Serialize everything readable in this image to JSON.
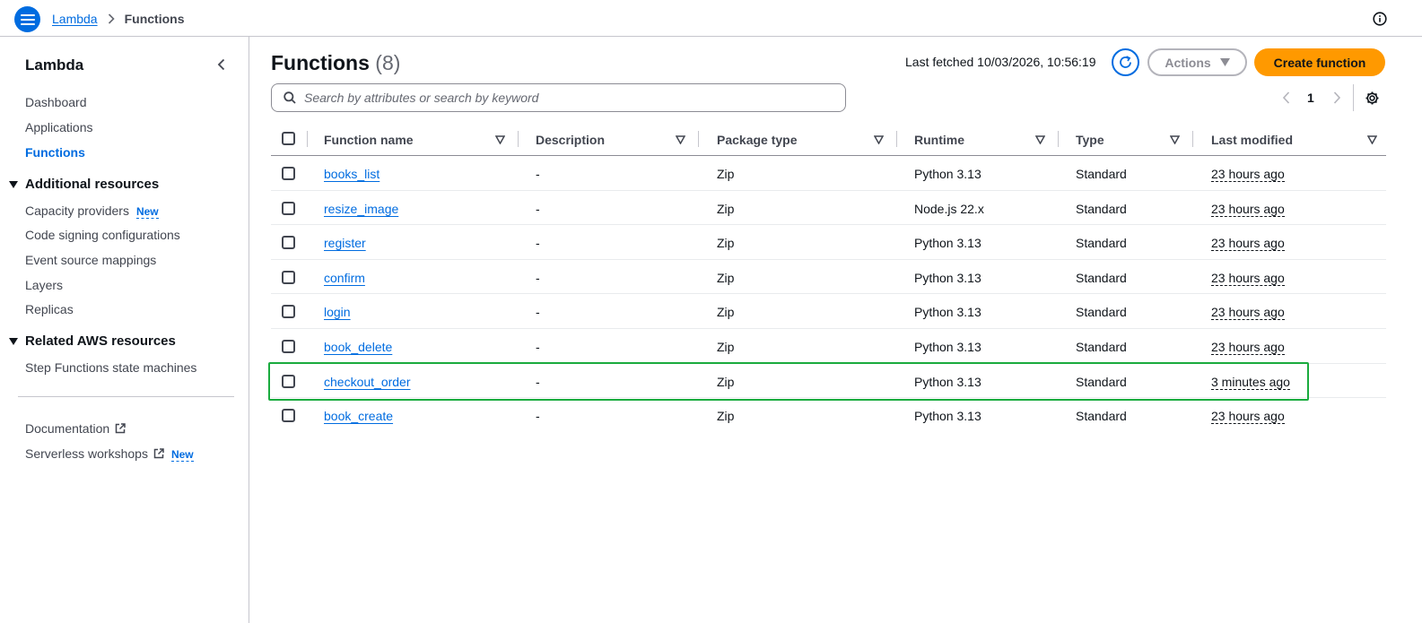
{
  "topbar": {
    "breadcrumb_root": "Lambda",
    "breadcrumb_current": "Functions"
  },
  "sidebar": {
    "title": "Lambda",
    "items": [
      {
        "label": "Dashboard"
      },
      {
        "label": "Applications"
      },
      {
        "label": "Functions"
      }
    ],
    "additional_resources": {
      "title": "Additional resources",
      "items": [
        {
          "label": "Capacity providers",
          "badge": "New"
        },
        {
          "label": "Code signing configurations"
        },
        {
          "label": "Event source mappings"
        },
        {
          "label": "Layers"
        },
        {
          "label": "Replicas"
        }
      ]
    },
    "related_resources": {
      "title": "Related AWS resources",
      "items": [
        {
          "label": "Step Functions state machines"
        }
      ]
    },
    "footer_links": [
      {
        "label": "Documentation"
      },
      {
        "label": "Serverless workshops",
        "badge": "New"
      }
    ]
  },
  "main": {
    "title": "Functions",
    "count": "(8)",
    "last_fetched": "Last fetched 10/03/2026, 10:56:19",
    "actions_label": "Actions",
    "create_label": "Create function",
    "search_placeholder": "Search by attributes or search by keyword",
    "page_number": "1"
  },
  "table": {
    "columns": [
      "Function name",
      "Description",
      "Package type",
      "Runtime",
      "Type",
      "Last modified"
    ],
    "rows": [
      {
        "name": "books_list",
        "description": "-",
        "package": "Zip",
        "runtime": "Python 3.13",
        "type": "Standard",
        "modified": "23 hours ago"
      },
      {
        "name": "resize_image",
        "description": "-",
        "package": "Zip",
        "runtime": "Node.js 22.x",
        "type": "Standard",
        "modified": "23 hours ago"
      },
      {
        "name": "register",
        "description": "-",
        "package": "Zip",
        "runtime": "Python 3.13",
        "type": "Standard",
        "modified": "23 hours ago"
      },
      {
        "name": "confirm",
        "description": "-",
        "package": "Zip",
        "runtime": "Python 3.13",
        "type": "Standard",
        "modified": "23 hours ago"
      },
      {
        "name": "login",
        "description": "-",
        "package": "Zip",
        "runtime": "Python 3.13",
        "type": "Standard",
        "modified": "23 hours ago"
      },
      {
        "name": "book_delete",
        "description": "-",
        "package": "Zip",
        "runtime": "Python 3.13",
        "type": "Standard",
        "modified": "23 hours ago"
      },
      {
        "name": "checkout_order",
        "description": "-",
        "package": "Zip",
        "runtime": "Python 3.13",
        "type": "Standard",
        "modified": "3 minutes ago"
      },
      {
        "name": "book_create",
        "description": "-",
        "package": "Zip",
        "runtime": "Python 3.13",
        "type": "Standard",
        "modified": "23 hours ago"
      }
    ]
  },
  "colors": {
    "link": "#006ce0",
    "primary_button": "#ff9900",
    "highlight_border": "#1aab3e"
  },
  "icons": [
    "menu-icon",
    "chevron-right-icon",
    "info-icon",
    "chevron-left-icon",
    "caret-down-icon",
    "external-link-icon",
    "refresh-icon",
    "search-icon",
    "settings-gear-icon",
    "sort-icon"
  ]
}
